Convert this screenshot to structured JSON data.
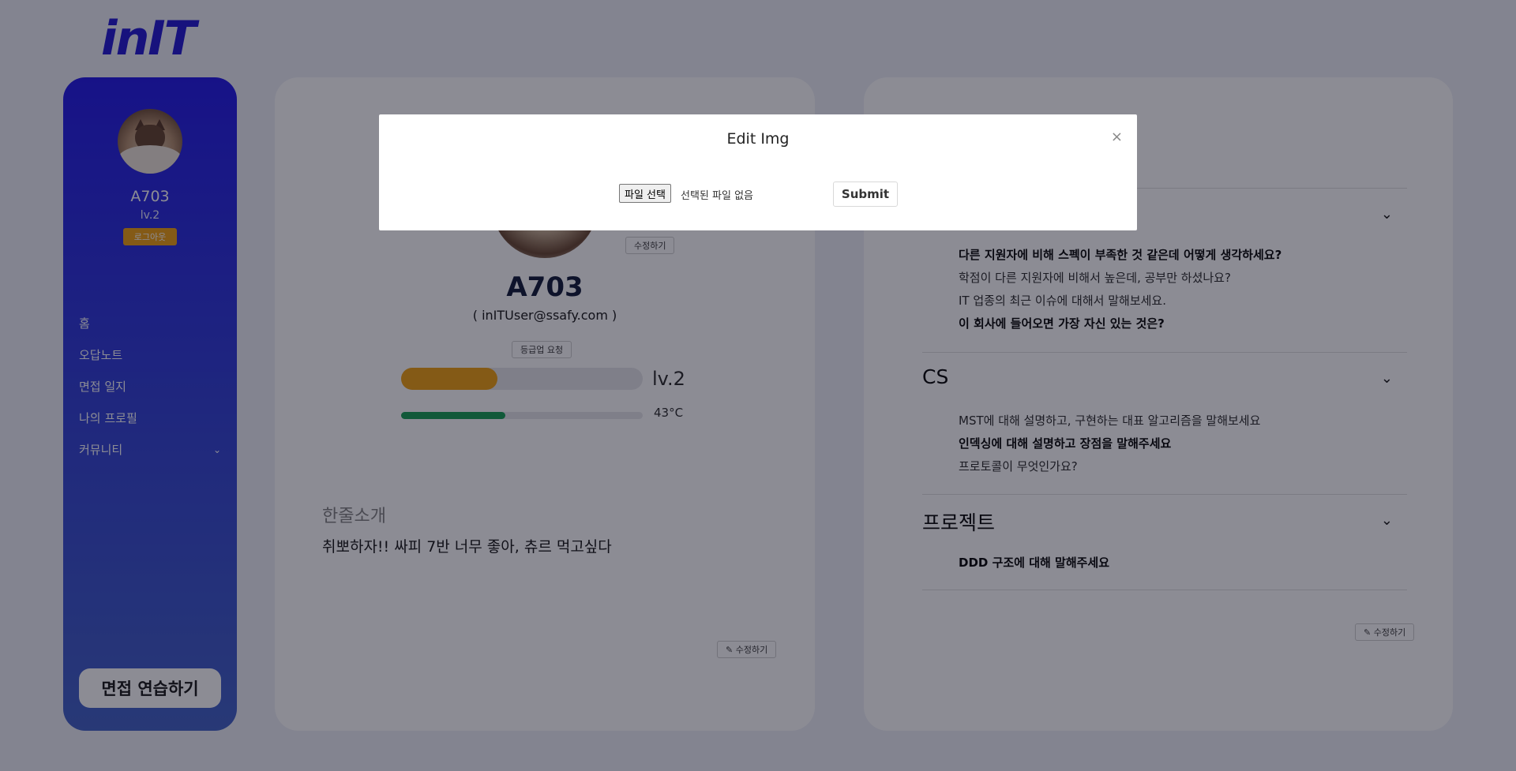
{
  "brand": {
    "logo": "inIT"
  },
  "sidebar": {
    "user_name": "A703",
    "level": "lv.2",
    "logout_label": "로그아웃",
    "items": [
      {
        "label": "홈"
      },
      {
        "label": "오답노트"
      },
      {
        "label": "면접 일지"
      },
      {
        "label": "나의 프로필"
      },
      {
        "label": "커뮤니티",
        "icon": "chevron-down-icon"
      }
    ],
    "practice_label": "면접 연습하기"
  },
  "profile": {
    "edit_photo_label": "수정하기",
    "name": "A703",
    "email": "( inITUser@ssafy.com )",
    "levelup_label": "등급업 요청",
    "exp_percent": 40,
    "level": "lv.2",
    "temperature_percent": 43,
    "temperature_label": "43°C",
    "intro_title": "한줄소개",
    "intro_text": "취뽀하자!! 싸피 7반 너무 좋아, 츄르 먹고싶다",
    "edit_intro_label": "수정하기"
  },
  "questions": {
    "sections": [
      {
        "title": "",
        "items": [
          {
            "text": "다른 지원자에 비해 스펙이 부족한 것 같은데 어떻게 생각하세요?",
            "bold": true
          },
          {
            "text": "학점이 다른 지원자에 비해서 높은데, 공부만 하셨나요?",
            "bold": false
          },
          {
            "text": "IT 업종의 최근 이슈에 대해서 말해보세요.",
            "bold": false
          },
          {
            "text": "이 회사에 들어오면 가장 자신 있는 것은?",
            "bold": true
          }
        ]
      },
      {
        "title": "CS",
        "items": [
          {
            "text": "MST에 대해 설명하고, 구현하는 대표 알고리즘을 말해보세요",
            "bold": false
          },
          {
            "text": "인덱싱에 대해 설명하고 장점을 말해주세요",
            "bold": true
          },
          {
            "text": "프로토콜이 무엇인가요?",
            "bold": false
          }
        ]
      },
      {
        "title": "프로젝트",
        "items": [
          {
            "text": "DDD 구조에 대해 말해주세요",
            "bold": true
          }
        ]
      }
    ],
    "edit_label": "수정하기"
  },
  "modal": {
    "title": "Edit Img",
    "close_icon": "×",
    "file_button_label": "파일 선택",
    "file_status": "선택된 파일 없음",
    "submit_label": "Submit"
  },
  "colors": {
    "brand": "#2a22d6",
    "sidebar_top": "#2a22e8",
    "sidebar_bottom": "#4968c9",
    "accent_orange": "#f0a51a",
    "temperature_green": "#1fa35a"
  }
}
